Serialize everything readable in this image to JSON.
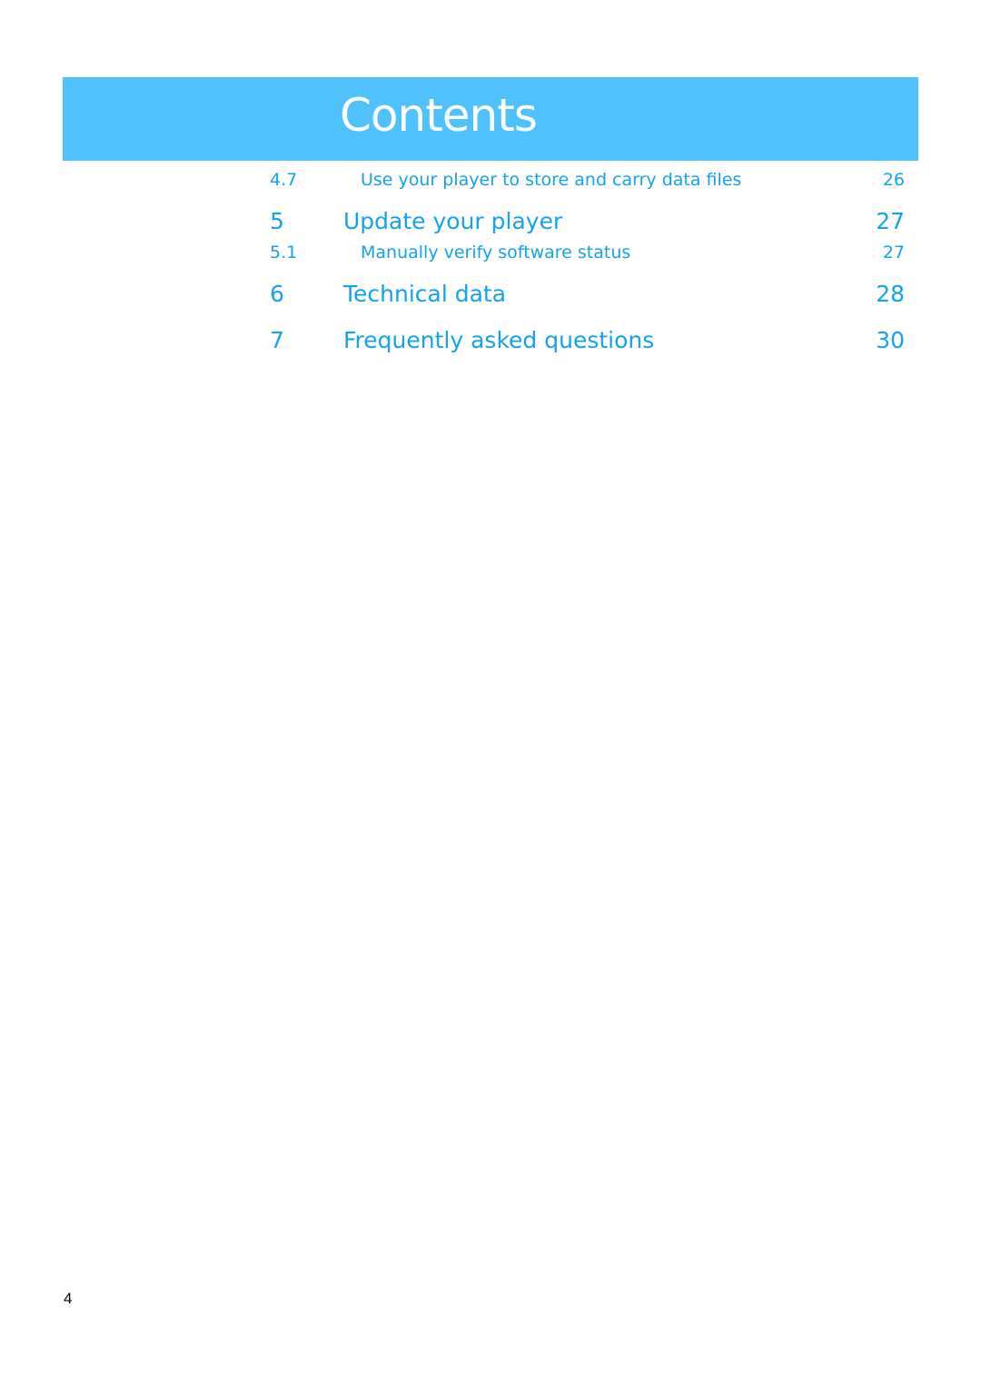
{
  "header": {
    "title": "Contents",
    "banner_color": "#4fc1fc",
    "text_color": "#13a2ee"
  },
  "toc": {
    "entries": [
      {
        "number": "4.7",
        "title": "Use your player to store and carry data files",
        "page": "26",
        "level": "sub"
      },
      {
        "number": "5",
        "title": "Update your player",
        "page": "27",
        "level": "main"
      },
      {
        "number": "5.1",
        "title": "Manually verify software status",
        "page": "27",
        "level": "sub"
      },
      {
        "number": "6",
        "title": "Technical data",
        "page": "28",
        "level": "main"
      },
      {
        "number": "7",
        "title": "Frequently asked questions",
        "page": "30",
        "level": "main"
      }
    ]
  },
  "footer": {
    "page_number": "4"
  }
}
